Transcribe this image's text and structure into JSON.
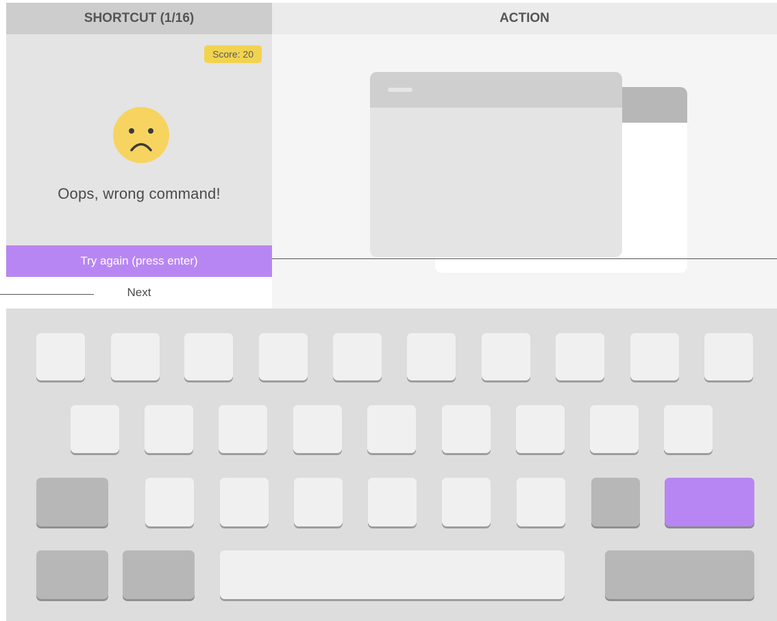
{
  "left_panel": {
    "header": "SHORTCUT (1/16)",
    "score": "Score: 20",
    "face_icon": "sad-face-icon",
    "message": "Oops, wrong command!",
    "try_again_label": "Try again (press enter)",
    "next_label": "Next"
  },
  "right_panel": {
    "header": "ACTION"
  },
  "colors": {
    "accent_purple": "#b886f2",
    "score_yellow": "#f2d34f",
    "face_yellow": "#f7d460",
    "key_light": "#f0f0f0",
    "key_dark": "#b7b7b7",
    "keyboard_bg": "#dedddd"
  },
  "keyboard": {
    "row1_key_count": 10,
    "row2_key_count": 9,
    "row3_key_count": 9,
    "row4_key_count": 4,
    "highlighted_key": "enter-key"
  }
}
